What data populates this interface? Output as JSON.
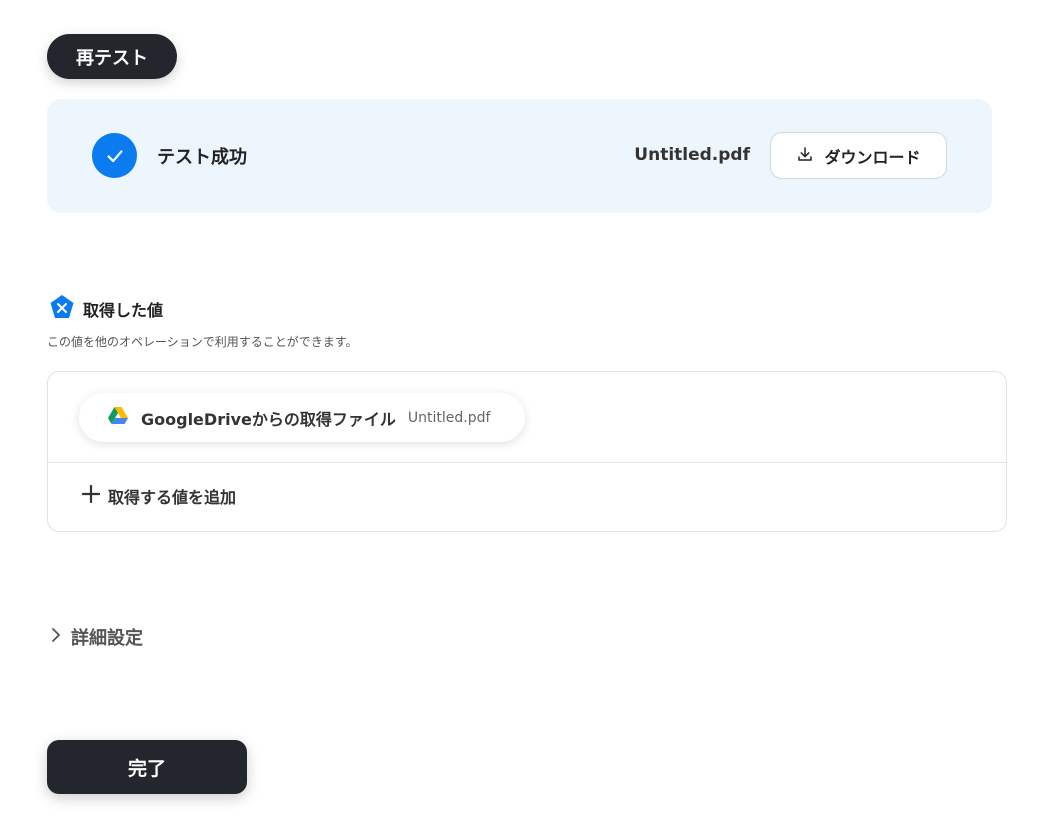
{
  "toolbar": {
    "retest_label": "再テスト"
  },
  "result": {
    "status_text": "テスト成功",
    "file_name": "Untitled.pdf",
    "download_label": "ダウンロード"
  },
  "retrieved": {
    "title": "取得した値",
    "description": "この値を他のオペレーションで利用することができます。",
    "items": [
      {
        "label": "GoogleDriveからの取得ファイル",
        "value": "Untitled.pdf",
        "icon": "google-drive-icon"
      }
    ],
    "add_label": "取得する値を追加"
  },
  "advanced": {
    "label": "詳細設定"
  },
  "footer": {
    "done_label": "完了"
  },
  "colors": {
    "primary_dark": "#23262d",
    "accent_blue": "#0a7cf0",
    "panel_bg": "#eef6fd"
  }
}
